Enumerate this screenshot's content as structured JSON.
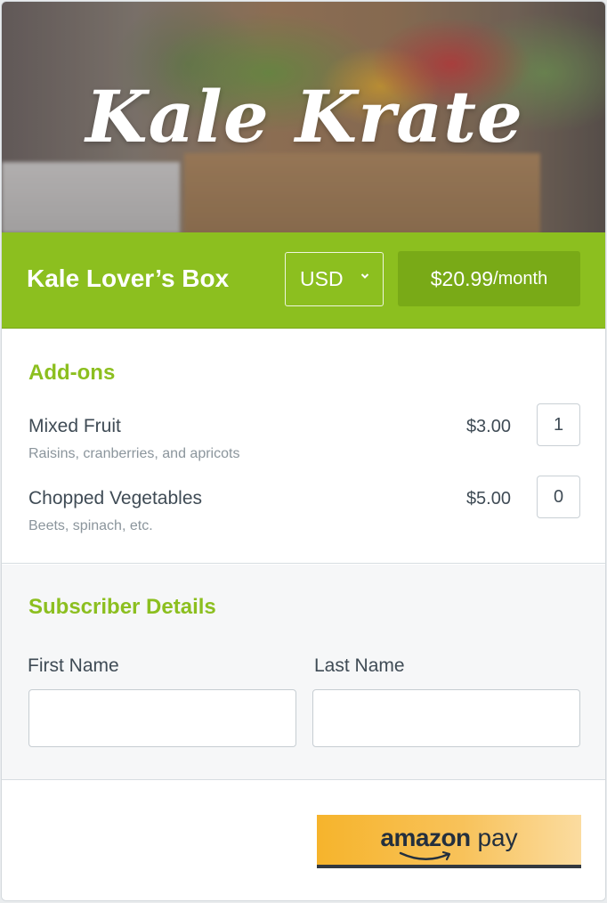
{
  "brand": {
    "name": "Kale Krate"
  },
  "plan": {
    "name": "Kale Lover’s Box",
    "currency": "USD",
    "price": "$20.99",
    "period": "/month"
  },
  "addons": {
    "title": "Add-ons",
    "items": [
      {
        "name": "Mixed Fruit",
        "description": "Raisins, cranberries, and apricots",
        "price": "$3.00",
        "quantity": "1"
      },
      {
        "name": "Chopped Vegetables",
        "description": "Beets, spinach, etc.",
        "price": "$5.00",
        "quantity": "0"
      }
    ]
  },
  "subscriber": {
    "title": "Subscriber Details",
    "first_name_label": "First Name",
    "first_name_value": "",
    "last_name_label": "Last Name",
    "last_name_value": ""
  },
  "payment": {
    "button_word1": "amazon",
    "button_word2": "pay"
  },
  "colors": {
    "accent_green": "#8cbf1f",
    "price_green": "#79aa17",
    "amazon_orange": "#f6b42c"
  }
}
